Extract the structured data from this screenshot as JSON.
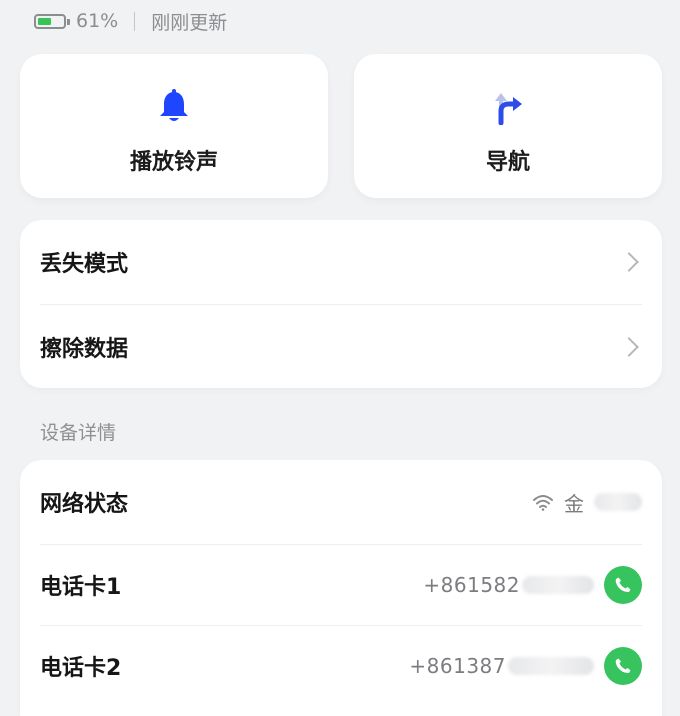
{
  "status": {
    "battery_percent_text": "61%",
    "battery_level": 0.61,
    "update_text": "刚刚更新",
    "battery_color": "#36c456"
  },
  "actions": [
    {
      "label": "播放铃声",
      "icon": "bell-icon",
      "color": "#1f46ff"
    },
    {
      "label": "导航",
      "icon": "navigation-turn-icon",
      "color": "#2d4ce8"
    }
  ],
  "security": {
    "items": [
      {
        "label": "丢失模式",
        "icon": "chevron-right-icon"
      },
      {
        "label": "擦除数据",
        "icon": "chevron-right-icon"
      }
    ]
  },
  "details": {
    "section_title": "设备详情",
    "rows": [
      {
        "label": "网络状态",
        "icon": "wifi-icon",
        "value_visible": "金"
      },
      {
        "label": "电话卡1",
        "phone_visible": "+861582",
        "icon": "phone-call-icon"
      },
      {
        "label": "电话卡2",
        "phone_visible": "+861387",
        "icon": "phone-call-icon"
      }
    ],
    "call_color": "#37c35d"
  }
}
